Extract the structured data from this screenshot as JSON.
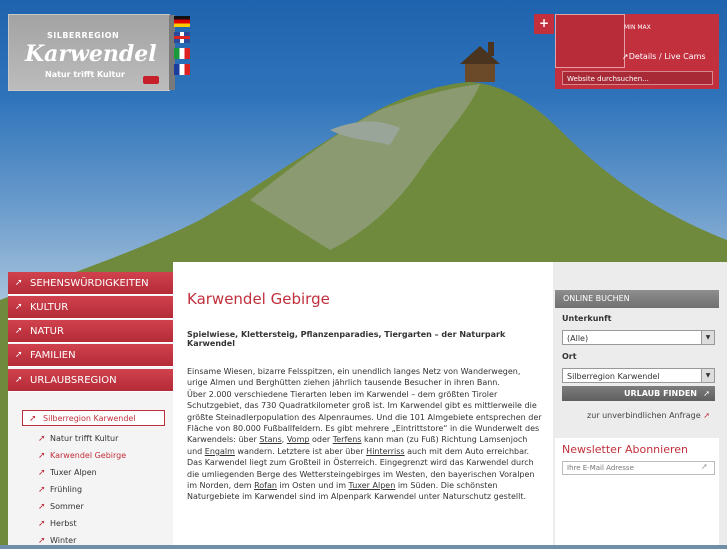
{
  "logo": {
    "line1": "SILBERREGION",
    "line2": "Karwendel",
    "line3": "Natur trifft Kultur"
  },
  "languages": [
    "de",
    "en",
    "it",
    "fr"
  ],
  "widget": {
    "plus": "+",
    "minmax": "MIN MAX",
    "details_link": "Details / Live Cams",
    "search_placeholder": "Website durchsuchen..."
  },
  "nav": {
    "items": [
      "SEHENSWÜRDIGKEITEN",
      "KULTUR",
      "NATUR",
      "FAMILIEN",
      "URLAUBSREGION"
    ],
    "selected_sub": "Silberregion Karwendel",
    "children": [
      "Natur trifft Kultur",
      "Karwendel Gebirge",
      "Tuxer Alpen",
      "Frühling",
      "Sommer",
      "Herbst",
      "Winter"
    ]
  },
  "main": {
    "title": "Karwendel Gebirge",
    "subtitle": "Spielwiese, Klettersteig, Pflanzenparadies, Tiergarten – der Naturpark Karwendel",
    "p1": "Einsame Wiesen, bizarre Felsspitzen, ein unendlich langes Netz von Wanderwegen, urige Almen und Berghütten ziehen jährlich tausende Besucher in ihren Bann.",
    "p2a": "Über 2.000 verschiedene Tierarten leben im Karwendel – dem größten Tiroler Schutzgebiet, das 730 Quadratkilometer groß ist. Im Karwendel gibt es mittlerweile die größte Steinadlerpopulation des Alpenraumes. Und die 101 Almgebiete entsprechen der Fläche von 80.000 Fußballfeldern. Es gibt mehrere „Eintrittstore“ in die Wunderwelt des Karwendels: über ",
    "link_stans": "Stans",
    "p2b": ", ",
    "link_vomp": "Vomp",
    "p2c": " oder ",
    "link_terfens": "Terfens",
    "p2d": " kann man (zu Fuß) Richtung Lamsenjoch und ",
    "link_engalm": "Engalm",
    "p2e": " wandern. Letztere ist aber über ",
    "link_hinterriss": "Hinterriss",
    "p2f": " auch mit dem Auto erreichbar.",
    "p3a": "Das Karwendel liegt zum Großteil in Österreich. Eingegrenzt wird das Karwendel durch die umliegenden Berge des Wettersteingebirges im Westen, den bayerischen Voralpen im Norden, dem ",
    "link_rofan": "Rofan",
    "p3b": " im Osten und im ",
    "link_tuxer": "Tuxer Alpen",
    "p3c": " im Süden. Die schönsten Naturgebiete im Karwendel sind im Alpenpark Karwendel unter Naturschutz gestellt."
  },
  "booking": {
    "header": "ONLINE BUCHEN",
    "unterkunft_label": "Unterkunft",
    "unterkunft_value": "(Alle)",
    "ort_label": "Ort",
    "ort_value": "Silberregion Karwendel",
    "find_button": "URLAUB FINDEN",
    "anfrage_link": "zur unverbindlichen Anfrage"
  },
  "newsletter": {
    "title": "Newsletter Abonnieren",
    "placeholder": "Ihre E-Mail Adresse"
  },
  "colors": {
    "accent": "#c0303c",
    "nav_red": "#c2303e"
  }
}
